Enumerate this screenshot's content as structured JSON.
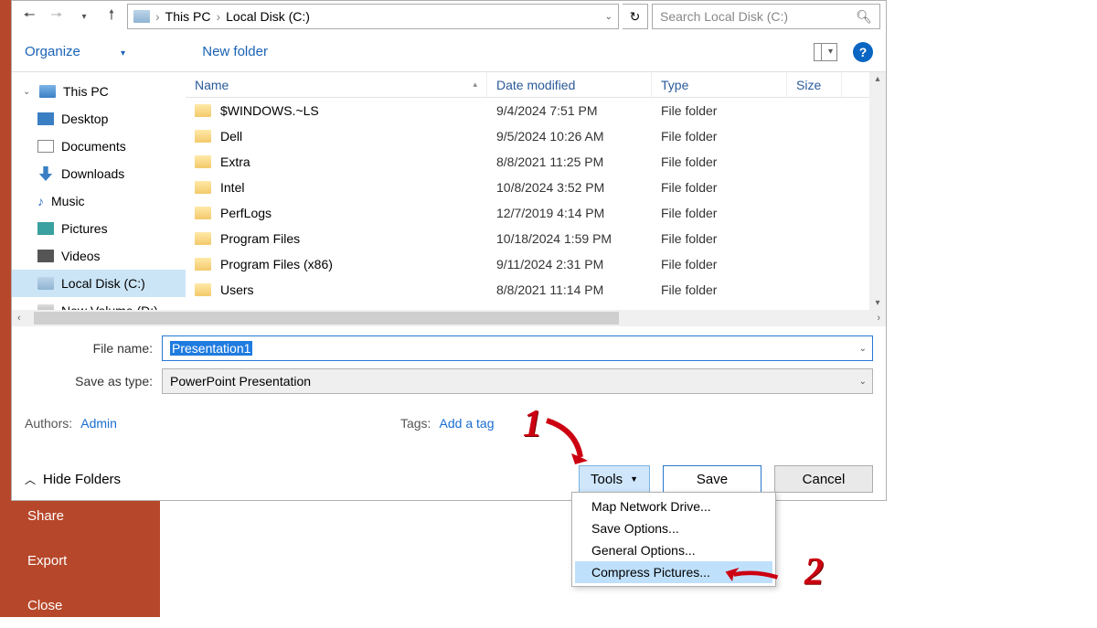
{
  "backstage": {
    "share": "Share",
    "export": "Export",
    "close": "Close"
  },
  "breadcrumb": {
    "root": "This PC",
    "loc": "Local Disk (C:)"
  },
  "search": {
    "placeholder": "Search Local Disk (C:)"
  },
  "toolbar": {
    "organize": "Organize",
    "newfolder": "New folder"
  },
  "tree": {
    "root": "This PC",
    "items": [
      "Desktop",
      "Documents",
      "Downloads",
      "Music",
      "Pictures",
      "Videos",
      "Local Disk (C:)",
      "New Volume (D:)"
    ]
  },
  "columns": {
    "name": "Name",
    "date": "Date modified",
    "type": "Type",
    "size": "Size"
  },
  "files": [
    {
      "name": "$WINDOWS.~LS",
      "date": "9/4/2024 7:51 PM",
      "type": "File folder"
    },
    {
      "name": "Dell",
      "date": "9/5/2024 10:26 AM",
      "type": "File folder"
    },
    {
      "name": "Extra",
      "date": "8/8/2021 11:25 PM",
      "type": "File folder"
    },
    {
      "name": "Intel",
      "date": "10/8/2024 3:52 PM",
      "type": "File folder"
    },
    {
      "name": "PerfLogs",
      "date": "12/7/2019 4:14 PM",
      "type": "File folder"
    },
    {
      "name": "Program Files",
      "date": "10/18/2024 1:59 PM",
      "type": "File folder"
    },
    {
      "name": "Program Files (x86)",
      "date": "9/11/2024 2:31 PM",
      "type": "File folder"
    },
    {
      "name": "Users",
      "date": "8/8/2021 11:14 PM",
      "type": "File folder"
    }
  ],
  "form": {
    "filename_label": "File name:",
    "filename_value": "Presentation1",
    "type_label": "Save as type:",
    "type_value": "PowerPoint Presentation",
    "authors_label": "Authors:",
    "authors_value": "Admin",
    "tags_label": "Tags:",
    "tags_value": "Add a tag"
  },
  "bottom": {
    "hide_folders": "Hide Folders",
    "tools": "Tools",
    "save": "Save",
    "cancel": "Cancel"
  },
  "tools_menu": [
    "Map Network Drive...",
    "Save Options...",
    "General Options...",
    "Compress Pictures..."
  ],
  "annotations": {
    "one": "1",
    "two": "2"
  }
}
